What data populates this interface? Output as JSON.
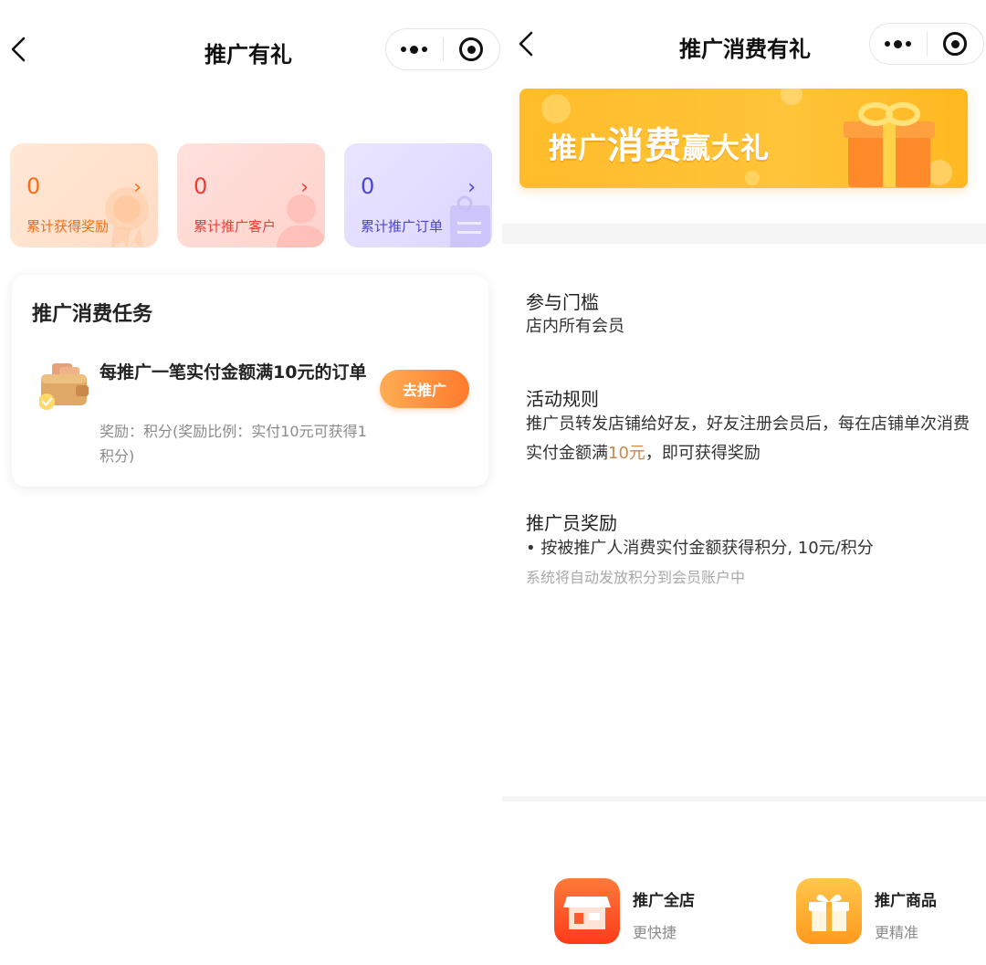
{
  "left": {
    "nav": {
      "title": "推广有礼",
      "back_icon": "chevron-left-icon",
      "more_icon": "more-dots-icon",
      "close_icon": "target-icon"
    },
    "stats": [
      {
        "value": "0",
        "label": "累计获得奖励",
        "color": "#ff6a12",
        "icon": "award-badge-icon"
      },
      {
        "value": "0",
        "label": "累计推广客户",
        "color": "#f03c34",
        "icon": "user-silhouette-icon"
      },
      {
        "value": "0",
        "label": "累计推广订单",
        "color": "#4a45d6",
        "icon": "order-document-icon"
      }
    ],
    "task": {
      "heading": "推广消费任务",
      "title": "每推广一笔实付金额满10元的订单",
      "reward": "奖励：积分(奖励比例：实付10元可获得1积分)",
      "button": "去推广",
      "icon": "wallet-icon"
    }
  },
  "right": {
    "nav": {
      "title": "推广消费有礼",
      "back_icon": "chevron-left-icon",
      "more_icon": "more-dots-icon",
      "close_icon": "target-icon"
    },
    "banner": {
      "text_a": "推广",
      "text_b": "消费",
      "text_c": "赢大礼",
      "icon": "gift-box-icon"
    },
    "threshold": {
      "title": "参与门槛",
      "text": "店内所有会员"
    },
    "rules": {
      "title": "活动规则",
      "text_before": "推广员转发店铺给好友，好友注册会员后，每在店铺单次消费实付金额满",
      "highlight": "10元",
      "text_after": "，即可获得奖励"
    },
    "reward": {
      "title": "推广员奖励",
      "bullet": "• 按被推广人消费实付金额获得积分, 10元/积分",
      "note": "系统将自动发放积分到会员账户中"
    },
    "bottom": [
      {
        "title": "推广全店",
        "subtitle": "更快捷",
        "icon": "storefront-icon",
        "color": "#ff5a2a"
      },
      {
        "title": "推广商品",
        "subtitle": "更精准",
        "icon": "gift-box-icon",
        "color": "#ffb02e"
      }
    ]
  }
}
